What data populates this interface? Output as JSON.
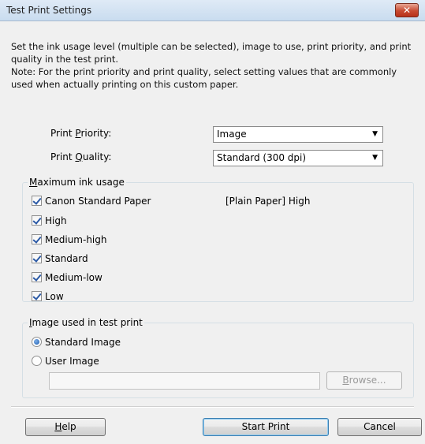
{
  "window": {
    "title": "Test Print Settings",
    "close_icon": "close-icon"
  },
  "description": "Set the ink usage level (multiple can be selected), image to use, print priority, and print\nquality in the test print.\nNote: For the print priority and print quality, select setting values that are commonly\nused when actually printing on this custom paper.",
  "print_priority": {
    "label_pre": "Print ",
    "label_key": "P",
    "label_post": "riority:",
    "value": "Image"
  },
  "print_quality": {
    "label_pre": "Print ",
    "label_key": "Q",
    "label_post": "uality:",
    "value": "Standard (300 dpi)"
  },
  "ink_usage": {
    "title_key": "M",
    "title_rest": "aximum ink usage",
    "media_note": "[Plain Paper] High",
    "items": [
      {
        "label": "Canon Standard Paper",
        "checked": true
      },
      {
        "label": "High",
        "checked": true
      },
      {
        "label": "Medium-high",
        "checked": true
      },
      {
        "label": "Standard",
        "checked": true
      },
      {
        "label": "Medium-low",
        "checked": true
      },
      {
        "label": "Low",
        "checked": true
      }
    ]
  },
  "image_group": {
    "title_key": "I",
    "title_rest": "mage used in test print",
    "options": [
      {
        "label": "Standard Image",
        "selected": true
      },
      {
        "label": "User Image",
        "selected": false
      }
    ],
    "path_value": "",
    "browse_key": "B",
    "browse_rest": "rowse..."
  },
  "buttons": {
    "help_key": "H",
    "help_rest": "elp",
    "start_print": "Start Print",
    "cancel": "Cancel"
  },
  "colors": {
    "accent": "#1b5cb0",
    "close": "#c74a31"
  }
}
